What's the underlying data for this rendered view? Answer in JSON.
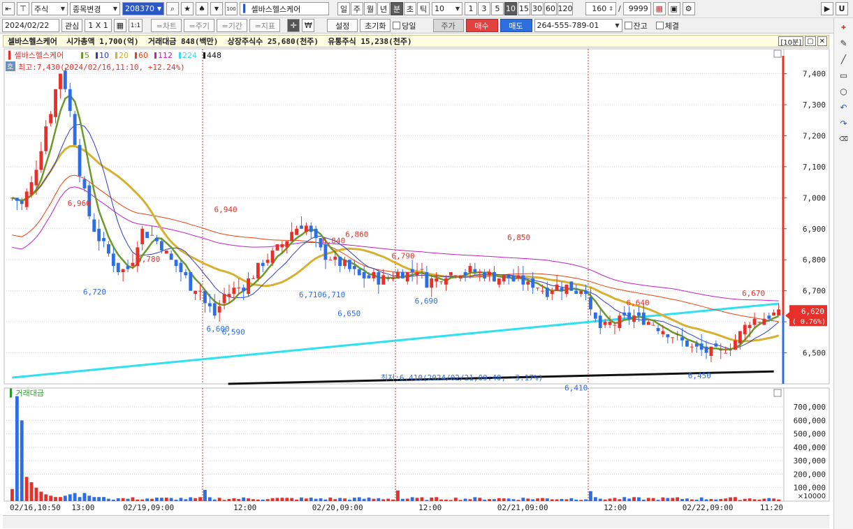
{
  "toolbar": {
    "market_select": "주식",
    "stock_change": "종목변경",
    "stock_code": "208370",
    "stock_name": "셀바스헬스케어",
    "periods": [
      "일",
      "주",
      "월",
      "년",
      "분",
      "초",
      "틱"
    ],
    "active_period": "분",
    "interval_value": "10",
    "minute_buttons": [
      "1",
      "3",
      "5",
      "10",
      "15",
      "30",
      "60",
      "120"
    ],
    "active_minute": "10",
    "view_count": "160",
    "total_count": "9999",
    "slash": "/",
    "right_button": "U"
  },
  "toolbar2": {
    "date": "2024/02/22",
    "watch_btn": "관심",
    "layout_btn": "1 X 1",
    "one_btn": "1:1",
    "tabs": [
      "=차트",
      "=주기",
      "=기간",
      "=지표"
    ],
    "won_btn": "₩",
    "settings_btn": "설정",
    "reset_btn": "초기화",
    "same_day_label": "당일",
    "price_btn": "주가",
    "buy_btn": "매수",
    "sell_btn": "매도",
    "account": "264-555-789-01",
    "balance_label": "잔고",
    "fill_label": "체결"
  },
  "info": {
    "summary": "셀바스헬스케어  시가총액 1,700(억)  거래대금 848(백만)  상장주식수 25,680(천주)  유통주식 15,238(천주)",
    "interval_tag": "[10분]"
  },
  "legend": {
    "name": "셀바스헬스케어",
    "items": [
      {
        "label": "5",
        "color": "#6b9a2b"
      },
      {
        "label": "10",
        "color": "#2b3bd0"
      },
      {
        "label": "20",
        "color": "#d8b030"
      },
      {
        "label": "60",
        "color": "#f04010"
      },
      {
        "label": "112",
        "color": "#c020c0"
      },
      {
        "label": "224",
        "color": "#30e0f0"
      },
      {
        "label": "448",
        "color": "#111111"
      }
    ],
    "high_note": "최고:7,430(2024/02/16,11:10, +12.24%)",
    "low_note": "최저:6,410(2024/02/21,09:40, -3.17%)",
    "badge": "호"
  },
  "colors": {
    "up": "#e8302a",
    "down": "#2d6ee6",
    "grid": "#d8d8d8",
    "cursor": "#cc3030"
  },
  "chart_data": {
    "type": "candlestick",
    "price_axis": {
      "ticks": [
        7400,
        7300,
        7200,
        7100,
        7000,
        6900,
        6800,
        6700,
        6600,
        6500
      ],
      "labels": [
        "7,400",
        "7,300",
        "7,200",
        "7,100",
        "7,000",
        "6,900",
        "6,800",
        "6,700",
        "6,600",
        "6,500"
      ]
    },
    "current_price": "6,620",
    "current_change": "( 0.76%)",
    "time_labels": [
      "02/16,10:50",
      "13:00",
      "02/19,09:00",
      "12:00",
      "02/20,09:00",
      "12:00",
      "02/21,09:00",
      "12:00",
      "02/22,09:00",
      "11:20"
    ],
    "annotations": [
      {
        "label": "6,960",
        "kind": "high"
      },
      {
        "label": "6,720",
        "kind": "low"
      },
      {
        "label": "6,780",
        "kind": "high"
      },
      {
        "label": "6,600",
        "kind": "low"
      },
      {
        "label": "6,590",
        "kind": "low"
      },
      {
        "label": "6,940",
        "kind": "high"
      },
      {
        "label": "6,710",
        "kind": "low"
      },
      {
        "label": "6,840",
        "kind": "high"
      },
      {
        "label": "6,710",
        "kind": "low"
      },
      {
        "label": "6,860",
        "kind": "high"
      },
      {
        "label": "6,650",
        "kind": "low"
      },
      {
        "label": "6,790",
        "kind": "high"
      },
      {
        "label": "6,690",
        "kind": "low"
      },
      {
        "label": "6,850",
        "kind": "high"
      },
      {
        "label": "6,410",
        "kind": "low"
      },
      {
        "label": "6,640",
        "kind": "high"
      },
      {
        "label": "6,450",
        "kind": "low"
      },
      {
        "label": "6,670",
        "kind": "high"
      }
    ],
    "session_close_keys": [
      [
        7000,
        6980,
        7050,
        7180,
        7300,
        7420,
        7250,
        7050,
        6920,
        6860,
        6800,
        6760,
        6780,
        6900,
        6880,
        6850,
        6800,
        6760,
        6720,
        6700
      ],
      [
        6660,
        6620,
        6690,
        6700,
        6720,
        6760,
        6800,
        6820,
        6860,
        6900,
        6920,
        6860,
        6820,
        6800,
        6780,
        6760,
        6740,
        6740,
        6740,
        6750
      ],
      [
        6760,
        6760,
        6770,
        6730,
        6740,
        6760,
        6770,
        6760,
        6760,
        6750,
        6740,
        6740,
        6730,
        6720,
        6720,
        6700,
        6710,
        6710,
        6700,
        6710
      ],
      [
        6620,
        6580,
        6590,
        6600,
        6620,
        6610,
        6600,
        6580,
        6560,
        6540,
        6520,
        6510,
        6500,
        6500,
        6520,
        6560,
        6600,
        6610,
        6620,
        6620
      ]
    ],
    "volume_panel": {
      "title": "거래대금",
      "ticks": [
        "700,000",
        "600,000",
        "500,000",
        "400,000",
        "300,000",
        "200,000",
        "100,000"
      ],
      "unit": "×10000",
      "values_key": [
        90000,
        780000,
        600000,
        180000,
        140000,
        100000,
        70000,
        50000,
        40000,
        30000,
        30000,
        40000,
        50000,
        60000,
        30000,
        60000,
        40000,
        30000,
        30000,
        30000
      ]
    },
    "ylim": [
      6400,
      7480
    ]
  }
}
